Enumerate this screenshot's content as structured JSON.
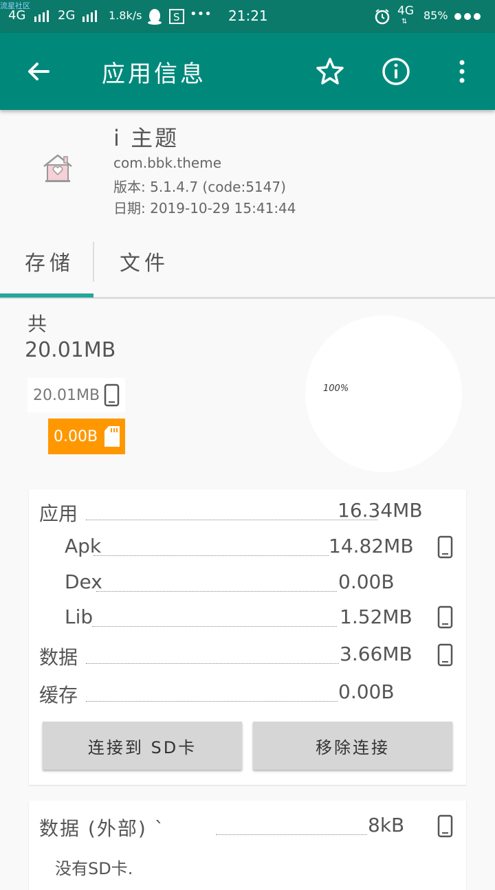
{
  "status_bar": {
    "watermark": "流星社区",
    "net1": "4G",
    "net2": "2G",
    "speed": "1.8k/s",
    "dots": "•••",
    "time": "21:21",
    "net3": "4G",
    "battery": "85%"
  },
  "toolbar": {
    "title": "应用信息",
    "back_icon": "arrow-left-icon",
    "star_icon": "star-outline-icon",
    "info_icon": "info-circle-icon",
    "menu_icon": "more-vertical-icon"
  },
  "app": {
    "name": "i 主题",
    "package": "com.bbk.theme",
    "version": "版本: 5.1.4.7 (code:5147)",
    "date": "日期: 2019-10-29 15:41:44"
  },
  "tabs": [
    {
      "label": "存储",
      "selected": true
    },
    {
      "label": "文件",
      "selected": false
    }
  ],
  "storage": {
    "total_label": "共",
    "total_value": "20.01MB",
    "legend_internal": "20.01MB",
    "legend_sd": "0.00B",
    "pie_label": "100%",
    "pie_internal_fraction": 1.0,
    "accent_sd": "#ff9800"
  },
  "breakdown": {
    "rows": [
      {
        "label": "应用",
        "value": "16.34MB",
        "icon": ""
      },
      {
        "label": "Apk",
        "value": "14.82MB",
        "icon": "phone-icon"
      },
      {
        "label": "Dex",
        "value": "0.00B",
        "icon": ""
      },
      {
        "label": "Lib",
        "value": "1.52MB",
        "icon": "phone-icon"
      },
      {
        "label": "数据",
        "value": "3.66MB",
        "icon": "phone-icon"
      },
      {
        "label": "缓存",
        "value": "0.00B",
        "icon": ""
      }
    ],
    "buttons": {
      "link_sd": "连接到 SD卡",
      "remove_link": "移除连接"
    }
  },
  "external": {
    "label": "数据 (外部) `",
    "value": "8kB",
    "icon": "phone-icon",
    "note": "没有SD卡."
  }
}
